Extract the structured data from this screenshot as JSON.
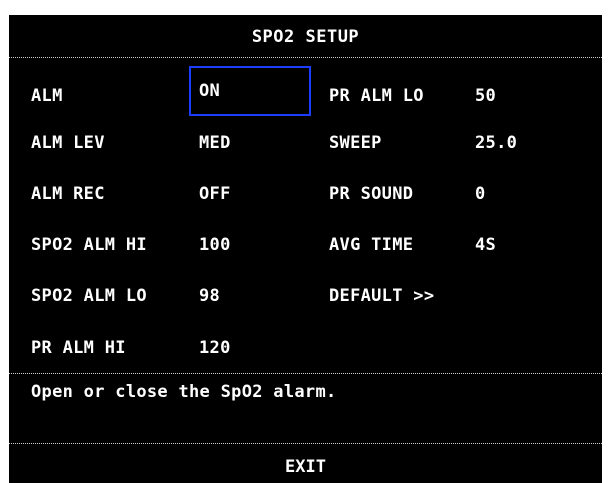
{
  "title": "SPO2 SETUP",
  "left_column": [
    {
      "label": "ALM",
      "value": "ON"
    },
    {
      "label": "ALM LEV",
      "value": "MED"
    },
    {
      "label": "ALM REC",
      "value": "OFF"
    },
    {
      "label": "SPO2 ALM HI",
      "value": "100"
    },
    {
      "label": "SPO2 ALM LO",
      "value": "98"
    },
    {
      "label": "PR ALM HI",
      "value": "120"
    }
  ],
  "right_column": [
    {
      "label": "PR ALM LO",
      "value": "50"
    },
    {
      "label": "SWEEP",
      "value": "25.0"
    },
    {
      "label": "PR SOUND",
      "value": "0"
    },
    {
      "label": "AVG TIME",
      "value": "4S"
    },
    {
      "label": "DEFAULT >>",
      "value": ""
    }
  ],
  "hint": "Open or close the SpO2 alarm.",
  "exit_label": "EXIT",
  "colors": {
    "background": "#000000",
    "text": "#ffffff",
    "focus_outline": "#1a3dff"
  }
}
